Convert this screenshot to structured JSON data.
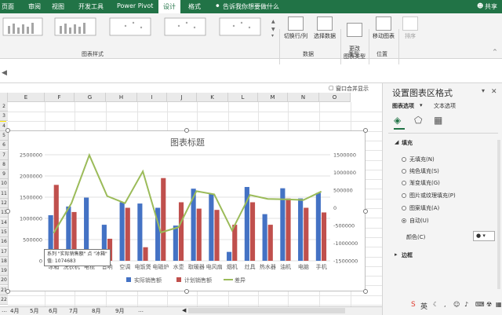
{
  "ribbon_tabs": [
    "页面",
    "审阅",
    "视图",
    "开发工具",
    "Power Pivot",
    "设计",
    "格式"
  ],
  "active_tab": "设计",
  "tell_me": "告诉我你想要做什么",
  "share": "共享",
  "groups": {
    "chart_styles": "图表样式",
    "data": "数据",
    "type": "类型",
    "location": "位置"
  },
  "buttons": {
    "switch_row_col": "切换行/列",
    "select_data": "选择数据",
    "change_chart_type": "更改\n图表类型",
    "move_chart": "移动图表",
    "sort": "排序"
  },
  "window_merge": "窗口合并显示",
  "columns": [
    "E",
    "F",
    "G",
    "H",
    "I",
    "J",
    "K",
    "L",
    "M",
    "N",
    "O"
  ],
  "rows": [
    "2",
    "3",
    "4",
    "5",
    "6",
    "7",
    "8",
    "9",
    "10",
    "11",
    "12",
    "13",
    "14",
    "15",
    "16",
    "17",
    "18",
    "19",
    "20",
    "21",
    "22"
  ],
  "sheet_tabs": [
    "4月",
    "5月",
    "6月",
    "7月",
    "8月",
    "9月"
  ],
  "pane": {
    "title": "设置图表区格式",
    "tab_chart_options": "图表选项",
    "tab_text_options": "文本选项",
    "section_fill": "填充",
    "fill_options": [
      "无填充(N)",
      "纯色填充(S)",
      "渐变填充(G)",
      "图片或纹理填充(P)",
      "图案填充(A)",
      "自动(U)"
    ],
    "selected_fill": "自动(U)",
    "color_label": "颜色(C)",
    "section_border": "边框"
  },
  "tooltip": {
    "line1": "系列 \"实际销售额\" 点 \"冰箱\"",
    "line2": "值: 1074683"
  },
  "taskbar": {
    "ime": "英"
  },
  "chart_data": {
    "type": "bar",
    "title": "图表标题",
    "categories": [
      "冰箱",
      "洗衣机",
      "电视",
      "音响",
      "空调",
      "电饭煲",
      "电磁炉",
      "水壶",
      "取暖器",
      "电风扇",
      "烟机",
      "灶具",
      "热水器",
      "油机",
      "电脑",
      "手机"
    ],
    "series": [
      {
        "name": "实际销售额",
        "kind": "bar",
        "axis": "left",
        "color": "#4472c4",
        "values": [
          1074683,
          1280000,
          1490000,
          850000,
          1380000,
          1350000,
          1250000,
          830000,
          1700000,
          1580000,
          210000,
          1740000,
          1100000,
          1710000,
          1470000,
          1600000
        ]
      },
      {
        "name": "计划销售额",
        "kind": "bar",
        "axis": "left",
        "color": "#c0504d",
        "values": [
          1790000,
          1150000,
          0,
          520000,
          1250000,
          320000,
          1950000,
          1380000,
          1230000,
          1200000,
          850000,
          1380000,
          850000,
          1470000,
          1250000,
          1140000
        ]
      },
      {
        "name": "差异",
        "kind": "line",
        "axis": "right",
        "color": "#9bbb59",
        "values": [
          -715317,
          130000,
          1490000,
          330000,
          130000,
          1030000,
          -700000,
          -550000,
          470000,
          380000,
          -640000,
          360000,
          250000,
          240000,
          220000,
          460000
        ]
      }
    ],
    "y_left": {
      "min": 0,
      "max": 2500000,
      "ticks": [
        0,
        500000,
        1000000,
        1500000,
        2000000,
        2500000
      ]
    },
    "y_right": {
      "min": -1500000,
      "max": 1500000,
      "ticks": [
        -1500000,
        -1000000,
        -500000,
        0,
        500000,
        1000000,
        1500000
      ]
    },
    "legend": "bottom",
    "grid": true
  }
}
